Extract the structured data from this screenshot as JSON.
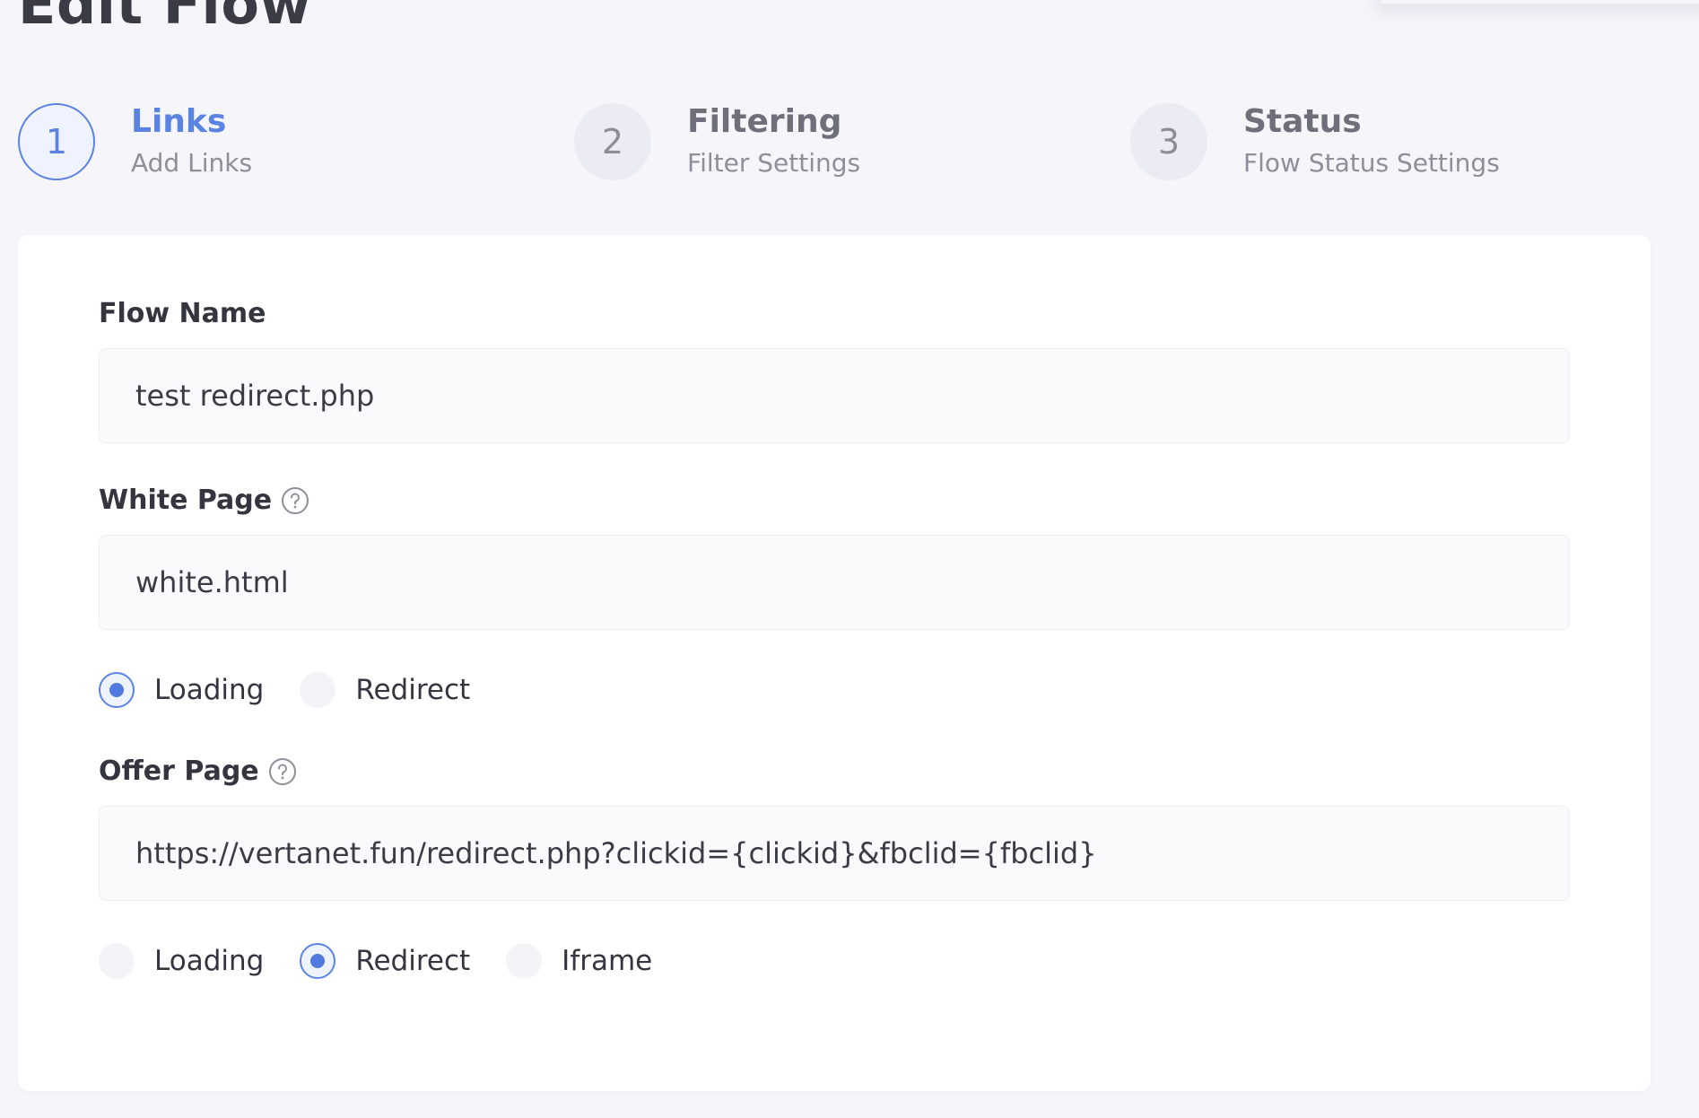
{
  "page": {
    "title": "Edit Flow"
  },
  "stepper": {
    "steps": [
      {
        "number": "1",
        "title": "Links",
        "subtitle": "Add Links",
        "active": true
      },
      {
        "number": "2",
        "title": "Filtering",
        "subtitle": "Filter Settings",
        "active": false
      },
      {
        "number": "3",
        "title": "Status",
        "subtitle": "Flow Status Settings",
        "active": false
      }
    ]
  },
  "form": {
    "flow_name": {
      "label": "Flow Name",
      "value": "test redirect.php"
    },
    "white_page": {
      "label": "White Page",
      "help_icon": "question-circle-icon",
      "value": "white.html",
      "modes": [
        {
          "label": "Loading",
          "checked": true
        },
        {
          "label": "Redirect",
          "checked": false
        }
      ]
    },
    "offer_page": {
      "label": "Offer Page",
      "help_icon": "question-circle-icon",
      "value": "https://vertanet.fun/redirect.php?clickid={clickid}&fbclid={fbclid}",
      "modes": [
        {
          "label": "Loading",
          "checked": false
        },
        {
          "label": "Redirect",
          "checked": true
        },
        {
          "label": "Iframe",
          "checked": false
        }
      ]
    }
  },
  "colors": {
    "accent": "#5b84e2",
    "background": "#f5f5fa",
    "card": "#ffffff",
    "text": "#3a3b45"
  }
}
